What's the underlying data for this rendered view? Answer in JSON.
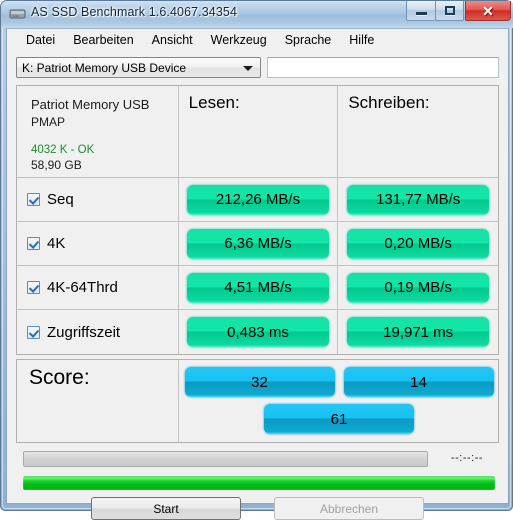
{
  "window": {
    "title": "AS SSD Benchmark 1.6.4067.34354",
    "icon": "drive-icon",
    "buttons": {
      "minimize": "minimize-icon",
      "maximize": "maximize-icon",
      "close": "✕"
    }
  },
  "menu": {
    "items": [
      {
        "label": "Datei"
      },
      {
        "label": "Bearbeiten"
      },
      {
        "label": "Ansicht"
      },
      {
        "label": "Werkzeug"
      },
      {
        "label": "Sprache"
      },
      {
        "label": "Hilfe"
      }
    ]
  },
  "drive_select": {
    "value": "K: Patriot Memory USB Device",
    "arrow": "chevron-down-icon"
  },
  "info_field": {
    "value": "",
    "placeholder": ""
  },
  "device": {
    "name": "Patriot Memory USB",
    "firmware": "PMAP",
    "alignment": "4032 K - OK",
    "alignment_color": "#1e8c2e",
    "capacity": "58,90 GB"
  },
  "columns": {
    "read": "Lesen:",
    "write": "Schreiben:"
  },
  "benchmarks": [
    {
      "label": "Seq",
      "checked": true,
      "read": "212,26 MB/s",
      "write": "131,77 MB/s"
    },
    {
      "label": "4K",
      "checked": true,
      "read": "6,36 MB/s",
      "write": "0,20 MB/s"
    },
    {
      "label": "4K-64Thrd",
      "checked": true,
      "read": "4,51 MB/s",
      "write": "0,19 MB/s"
    },
    {
      "label": "Zugriffszeit",
      "checked": true,
      "read": "0,483 ms",
      "write": "19,971 ms"
    }
  ],
  "score": {
    "label": "Score:",
    "read": "32",
    "write": "14",
    "total": "61"
  },
  "progress": {
    "task_percent": 0,
    "overall_percent": 100,
    "timer": "--:--:--"
  },
  "actions": {
    "start": "Start",
    "cancel": "Abbrechen"
  },
  "colors": {
    "value_bar_green": "#00c98e",
    "score_bar_blue": "#0b9ac4",
    "progress_green": "#03c016",
    "ok_green": "#1e8c2e",
    "title_close_red": "#cc2f26"
  }
}
